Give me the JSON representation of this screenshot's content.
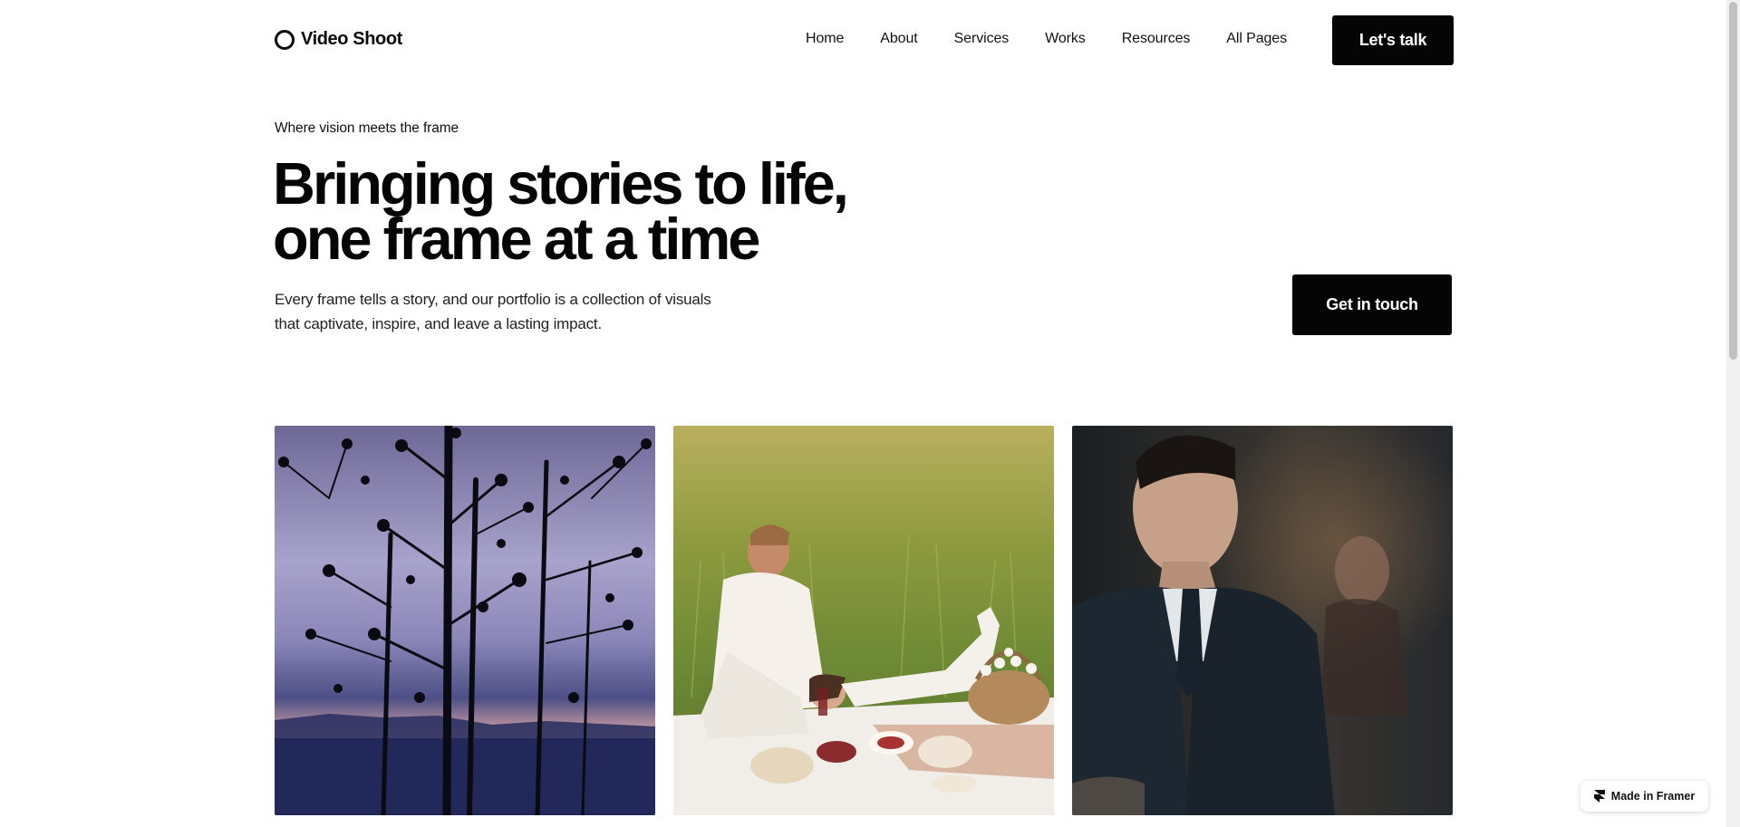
{
  "brand": {
    "name": "Video Shoot",
    "icon": "circle-logo-icon"
  },
  "nav": {
    "items": [
      {
        "label": "Home"
      },
      {
        "label": "About"
      },
      {
        "label": "Services"
      },
      {
        "label": "Works"
      },
      {
        "label": "Resources"
      },
      {
        "label": "All Pages"
      }
    ],
    "cta_label": "Let's talk"
  },
  "hero": {
    "tagline": "Where vision meets the frame",
    "headline_line1": "Bringing stories to life,",
    "headline_line2": "one frame at a time",
    "description_line1": "Every frame tells a story, and our portfolio is a collection of visuals",
    "description_line2": "that captivate, inspire, and leave a lasting impact.",
    "cta_label": "Get in touch"
  },
  "gallery": {
    "photos": [
      {
        "subject": "tree-silhouette-at-dusk"
      },
      {
        "subject": "couple-picnic-in-field"
      },
      {
        "subject": "man-in-suit-portrait"
      }
    ]
  },
  "badge": {
    "label": "Made in Framer",
    "icon": "framer-icon"
  },
  "colors": {
    "primary": "#050505",
    "background": "#ffffff",
    "text": "#0a0a0a"
  }
}
